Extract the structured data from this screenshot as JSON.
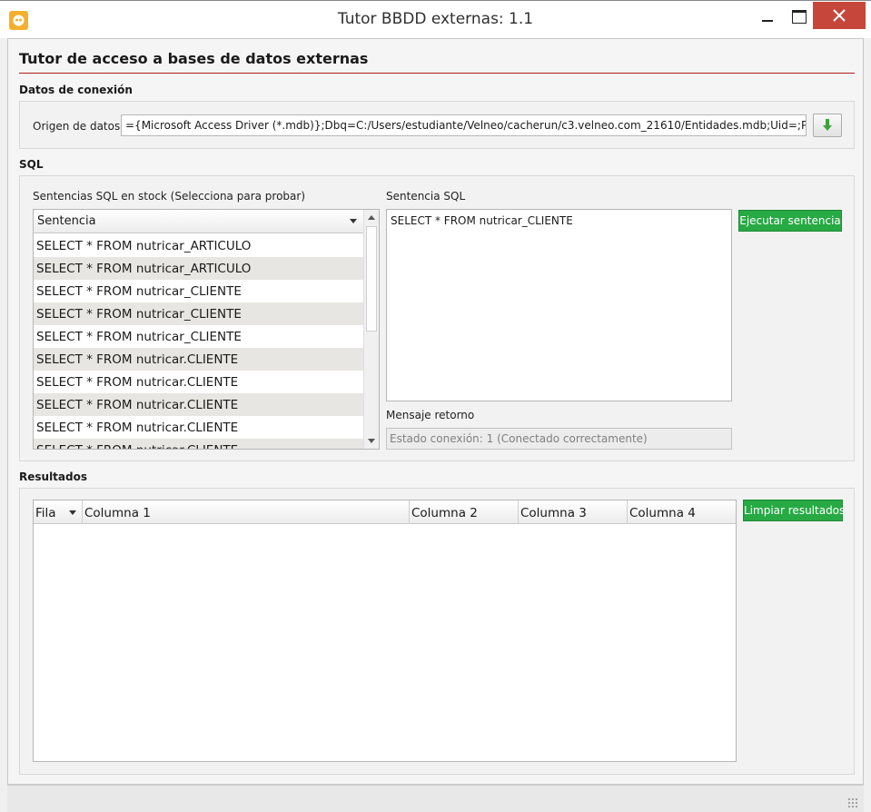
{
  "window": {
    "title": "Tutor BBDD externas: 1.1"
  },
  "page": {
    "heading": "Tutor de acceso a bases de datos externas"
  },
  "connection": {
    "section_label": "Datos de conexión",
    "source_label": "Origen de datos",
    "source_value": "={Microsoft Access Driver (*.mdb)};Dbq=C:/Users/estudiante/Velneo/cacherun/c3.velneo.com_21610/Entidades.mdb;Uid=;Pwd=;",
    "load_icon": "green-down-arrow-icon"
  },
  "sql": {
    "section_label": "SQL",
    "stock_label": "Sentencias SQL en stock (Selecciona para probar)",
    "list_header": "Sentencia",
    "statements": [
      "SELECT * FROM nutricar_ARTICULO",
      "SELECT * FROM nutricar_ARTICULO",
      "SELECT * FROM nutricar_CLIENTE",
      "SELECT * FROM nutricar_CLIENTE",
      "SELECT * FROM nutricar_CLIENTE",
      "SELECT * FROM nutricar.CLIENTE",
      "SELECT * FROM nutricar.CLIENTE",
      "SELECT * FROM nutricar.CLIENTE",
      "SELECT * FROM nutricar.CLIENTE",
      "SELECT * FROM nutricar.CLIENTE"
    ],
    "editor_label": "Sentencia SQL",
    "editor_value": "SELECT * FROM nutricar_CLIENTE",
    "execute_button": "Ejecutar sentencia",
    "message_label": "Mensaje retorno",
    "message_value": "Estado conexión:  1 (Conectado correctamente)"
  },
  "results": {
    "section_label": "Resultados",
    "columns": [
      "Fila",
      "Columna 1",
      "Columna 2",
      "Columna 3",
      "Columna 4"
    ],
    "clear_button": "Limpiar resultados"
  },
  "colors": {
    "accent_rule": "#b11c1c",
    "button_green": "#27a944",
    "close_red": "#c7463c"
  }
}
